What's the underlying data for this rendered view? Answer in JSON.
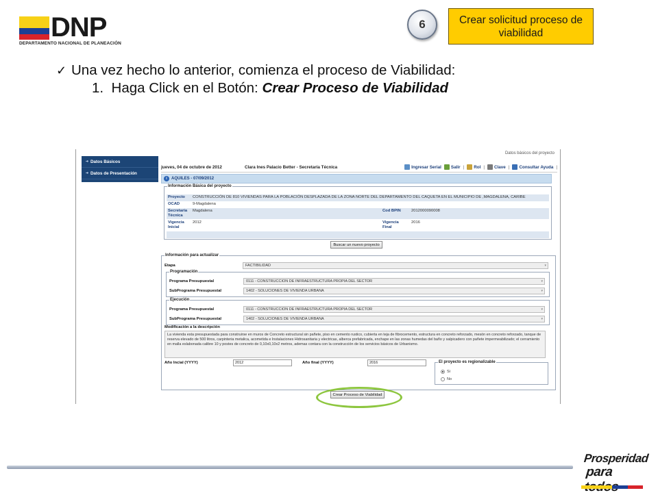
{
  "slide": {
    "logo_word": "DNP",
    "logo_sub": "DEPARTAMENTO NACIONAL DE PLANEACIÓN",
    "step_number": "6",
    "step_label": "Crear solicitud proceso de viabilidad",
    "bullet_text": "Una vez hecho lo anterior, comienza el proceso de Viabilidad:",
    "numbered_prefix": "1.",
    "numbered_text": "Haga Click en el Botón: ",
    "numbered_emphasis": "Crear Proceso de Viabilidad",
    "footer_logo_line1": "Prosperidad",
    "footer_logo_line2": "para todos",
    "colors": {
      "step_box": "#ffcc00",
      "highlight": "#8dc63f",
      "nav": "#1c4576"
    }
  },
  "app": {
    "top_caption": "Datos básicos del proyecto",
    "nav": [
      "Datos Básicos",
      "Datos de Presentación"
    ],
    "header": {
      "date": "jueves, 04 de octubre de 2012",
      "user": "Clara Ines Palacio Better - Secretaría Técnica",
      "links": [
        {
          "label": "Ingresar Serial",
          "icon": "serial-icon"
        },
        {
          "label": "Salir",
          "icon": "exit-icon"
        },
        {
          "label": "Rol",
          "icon": "role-icon"
        },
        {
          "label": "Clave",
          "icon": "key-icon"
        },
        {
          "label": "Consultar Ayuda",
          "icon": "help-icon"
        }
      ]
    },
    "project_bar": "AQUILES - 07/09/2012",
    "basic_info": {
      "legend": "Información Básica del proyecto",
      "proyecto_label": "Proyecto",
      "proyecto_value": "CONSTRUCCIÓN DE 810 VIVIENDAS PARA LA POBLACIÓN DESPLAZADA DE LA ZONA NORTE DEL DEPARTAMENTO DEL CAQUETA EN EL MUNICIPIO DE ,MAGDALENA, CARIBE",
      "ocad_label": "OCAD",
      "ocad_value": "9-Magdalena",
      "secretaria_label": "Secretaria Técnica",
      "secretaria_value": "Magdalena",
      "bpin_label": "Cod BPIN",
      "bpin_value": "2012000090008",
      "vig_ini_label": "Vigencia Inicial",
      "vig_ini_value": "2012",
      "vig_fin_label": "Vigencia Final",
      "vig_fin_value": "2016"
    },
    "search_button": "Buscar un nuevo proyecto",
    "update": {
      "legend": "Información para actualizar",
      "etapa_label": "Etapa",
      "etapa_value": "FACTIBILIDAD",
      "programacion_legend": "Programación",
      "ejecucion_legend": "Ejecución",
      "programa_label": "Programa Presupuestal",
      "programa_value": "0111 - CONSTRUCCION DE INFRAESTRUCTURA PROPIA DEL SECTOR",
      "subprograma_label": "SubPrograma Presupuestal",
      "subprograma_value": "1402 - SOLUCIONES DE VIVIENDA URBANA",
      "descripcion_label": "Modificación a la descripción",
      "descripcion_value": "La vivienda esta presupuestada para construirse en muros de Concreto estructural sin pañete, piso en cemento rustico, cubierta en teja de fibrocemento, estructura en concreto reforzado, mesón en concreto reforzado, tanque de reserva elevado de 500 litros, carpinteria metalica, acometida e Instalaciones Hidrosanitaria y electricas, alberca prefabricada, enchape en las zonas humedas del baño y salpicadero con pañete impermeabilizado; el cerramiento en malla eslabonada calibre 10 y postes de concreto de 0,10x0,10x2 metros, ademas contara con la construcción de los servicios básicos de Urbanismo.",
      "anio_ini_label": "Año Incial (YYYY)",
      "anio_ini_value": "2012",
      "anio_fin_label": "Año final (YYYY)",
      "anio_fin_value": "2016",
      "regional_legend": "El proyecto es regionalizable",
      "radio_si": "Si",
      "radio_no": "No",
      "selected_radio": "Si"
    },
    "create_button": "Crear Proceso de Viabilidad"
  }
}
